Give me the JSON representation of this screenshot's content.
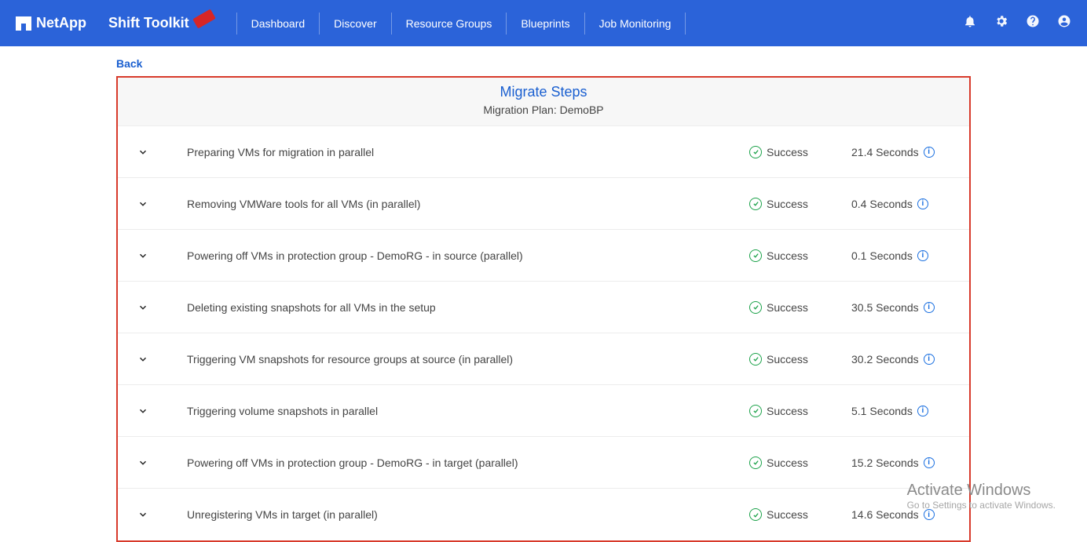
{
  "brand": {
    "company": "NetApp",
    "product": "Shift Toolkit"
  },
  "nav": {
    "items": [
      "Dashboard",
      "Discover",
      "Resource Groups",
      "Blueprints",
      "Job Monitoring"
    ]
  },
  "back_label": "Back",
  "panel": {
    "title": "Migrate Steps",
    "subtitle": "Migration Plan: DemoBP"
  },
  "status_label": "Success",
  "steps": [
    {
      "label": "Preparing VMs for migration in parallel",
      "time": "21.4 Seconds"
    },
    {
      "label": "Removing VMWare tools for all VMs (in parallel)",
      "time": "0.4 Seconds"
    },
    {
      "label": "Powering off VMs in protection group - DemoRG - in source (parallel)",
      "time": "0.1 Seconds"
    },
    {
      "label": "Deleting existing snapshots for all VMs in the setup",
      "time": "30.5 Seconds"
    },
    {
      "label": "Triggering VM snapshots for resource groups at source (in parallel)",
      "time": "30.2 Seconds"
    },
    {
      "label": "Triggering volume snapshots in parallel",
      "time": "5.1 Seconds"
    },
    {
      "label": "Powering off VMs in protection group - DemoRG - in target (parallel)",
      "time": "15.2 Seconds"
    },
    {
      "label": "Unregistering VMs in target (in parallel)",
      "time": "14.6 Seconds"
    }
  ],
  "watermark": {
    "title": "Activate Windows",
    "sub": "Go to Settings to activate Windows."
  }
}
